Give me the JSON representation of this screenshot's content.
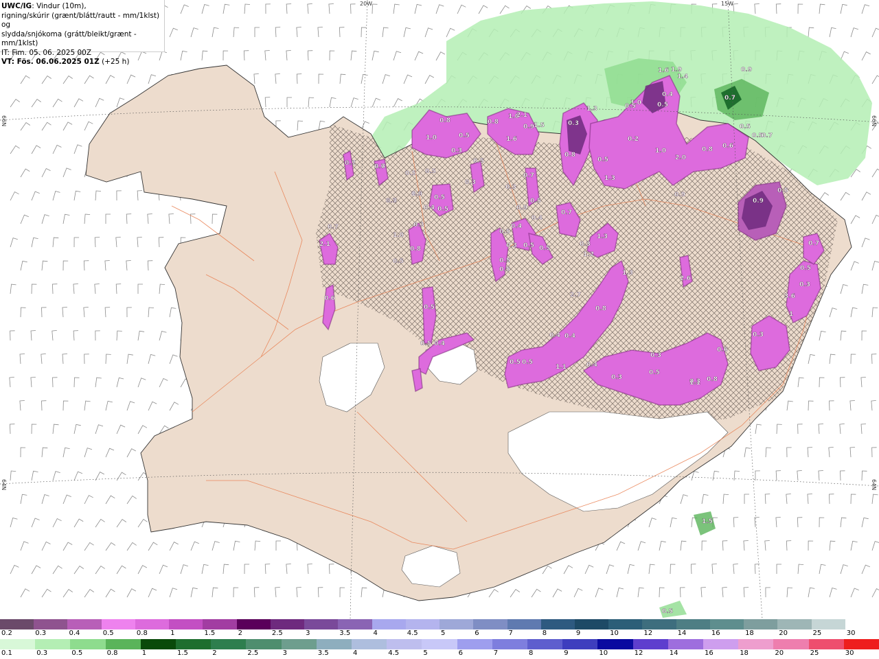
{
  "header": {
    "model": "UWC/IG",
    "line1_rest": ": Vindur (10m),",
    "line2": "rigning/skúrir (grænt/blátt/rautt - mm/1klst) og",
    "line3": "slydda/snjókoma (grátt/bleikt/grænt - mm/1klst)",
    "line4": "IT: Fim. 05. 06. 2025 00Z",
    "line5_bold": "VT: Fös. 06.06.2025 01Z",
    "line5_rest": " (+25 h)"
  },
  "graticule": {
    "top_labels": [
      "20W",
      "15W"
    ],
    "side_labels": [
      "66N",
      "64N"
    ]
  },
  "map_labels": [
    "0.1",
    "2.0",
    "0.5",
    "0.3",
    "0.5",
    "0.7",
    "2.1",
    "0.6",
    "0.5",
    "0.5",
    "0.8",
    "1.0",
    "0.5",
    "0.3",
    "0.8",
    "1.0",
    "0.5",
    "0.5",
    "0.4",
    "0.3",
    "0.5",
    "0.3",
    "0.5",
    "0.5",
    "0.3",
    "0.5",
    "0.4",
    "0.4",
    "0.5",
    "0.3",
    "0.5",
    "0.5",
    "0.4",
    "0.5",
    "0.8",
    "1.0",
    "0.9",
    "2.1",
    "1.5",
    "1.6",
    "0.7",
    "0.9",
    "0.5",
    "0.5",
    "0.5",
    "0.3",
    "0.8",
    "0.5",
    "0.3",
    "1.2",
    "1.3",
    "2.7",
    "1.3",
    "0.8",
    "0.4",
    "0.4",
    "1.1",
    "0.4",
    "0.3",
    "1.0",
    "0.2",
    "0.5",
    "0.4",
    "1.9",
    "1.6",
    "2.0",
    "1.0",
    "0.8",
    "0.6",
    "0.9",
    "0.7",
    "0.9",
    "0.5",
    "0.5",
    "0.9",
    "0.5",
    "2.6",
    "0.7",
    "0.5",
    "0.3",
    "3.6",
    "1",
    "0.3",
    "0.6",
    "0.3",
    "0.5",
    "0.3",
    "0.8",
    "1.1",
    "1.5",
    "0.5",
    "0.5",
    "1.3",
    "1.4",
    "0.7",
    "1.3",
    "0.7",
    "0.7",
    "0.7",
    "0.7",
    "1.0"
  ],
  "legend": {
    "snow": {
      "labels": [
        "0.2",
        "0.3",
        "0.4",
        "0.5",
        "0.8",
        "1",
        "1.5",
        "2",
        "2.5",
        "3",
        "3.5",
        "4",
        "4.5",
        "5",
        "6",
        "7",
        "8",
        "9",
        "10",
        "12",
        "14",
        "16",
        "18",
        "20",
        "25",
        "30"
      ],
      "colors": [
        "#6b4a6a",
        "#8f538f",
        "#b85fb8",
        "#ee82ee",
        "#dd6bdd",
        "#c34fc3",
        "#a23da2",
        "#5a005a",
        "#6e2a7e",
        "#7a4a9a",
        "#8a64b4",
        "#a8a8ee",
        "#b4b4ee",
        "#9ea8d8",
        "#7f8ec4",
        "#5f7ab0",
        "#2e5a80",
        "#1e4a66",
        "#2c5e78",
        "#3e6e7e",
        "#4e7e84",
        "#5e8e8e",
        "#7e9e9e",
        "#9eb6b6",
        "#c6d6d6",
        "#ffffff"
      ]
    },
    "rain": {
      "labels": [
        "0.1",
        "0.3",
        "0.5",
        "0.8",
        "1",
        "1.5",
        "2",
        "2.5",
        "3",
        "3.5",
        "4",
        "4.5",
        "5",
        "6",
        "7",
        "8",
        "9",
        "10",
        "12",
        "14",
        "16",
        "18",
        "20",
        "25",
        "30"
      ],
      "colors": [
        "#d8f8d8",
        "#b4eeb4",
        "#8edc8e",
        "#5ab45a",
        "#0a4a0a",
        "#1e6e2e",
        "#2e7e4e",
        "#4e8e6e",
        "#6e9e8e",
        "#8eaebe",
        "#aebede",
        "#bebeee",
        "#c8c8f8",
        "#9e9eee",
        "#7e7ede",
        "#5e5ece",
        "#3e3ebe",
        "#0a0aa0",
        "#5e3ece",
        "#9e6ede",
        "#ce9eee",
        "#ee9ece",
        "#ee7eae",
        "#ee4e6e",
        "#ee1e1e"
      ]
    }
  }
}
